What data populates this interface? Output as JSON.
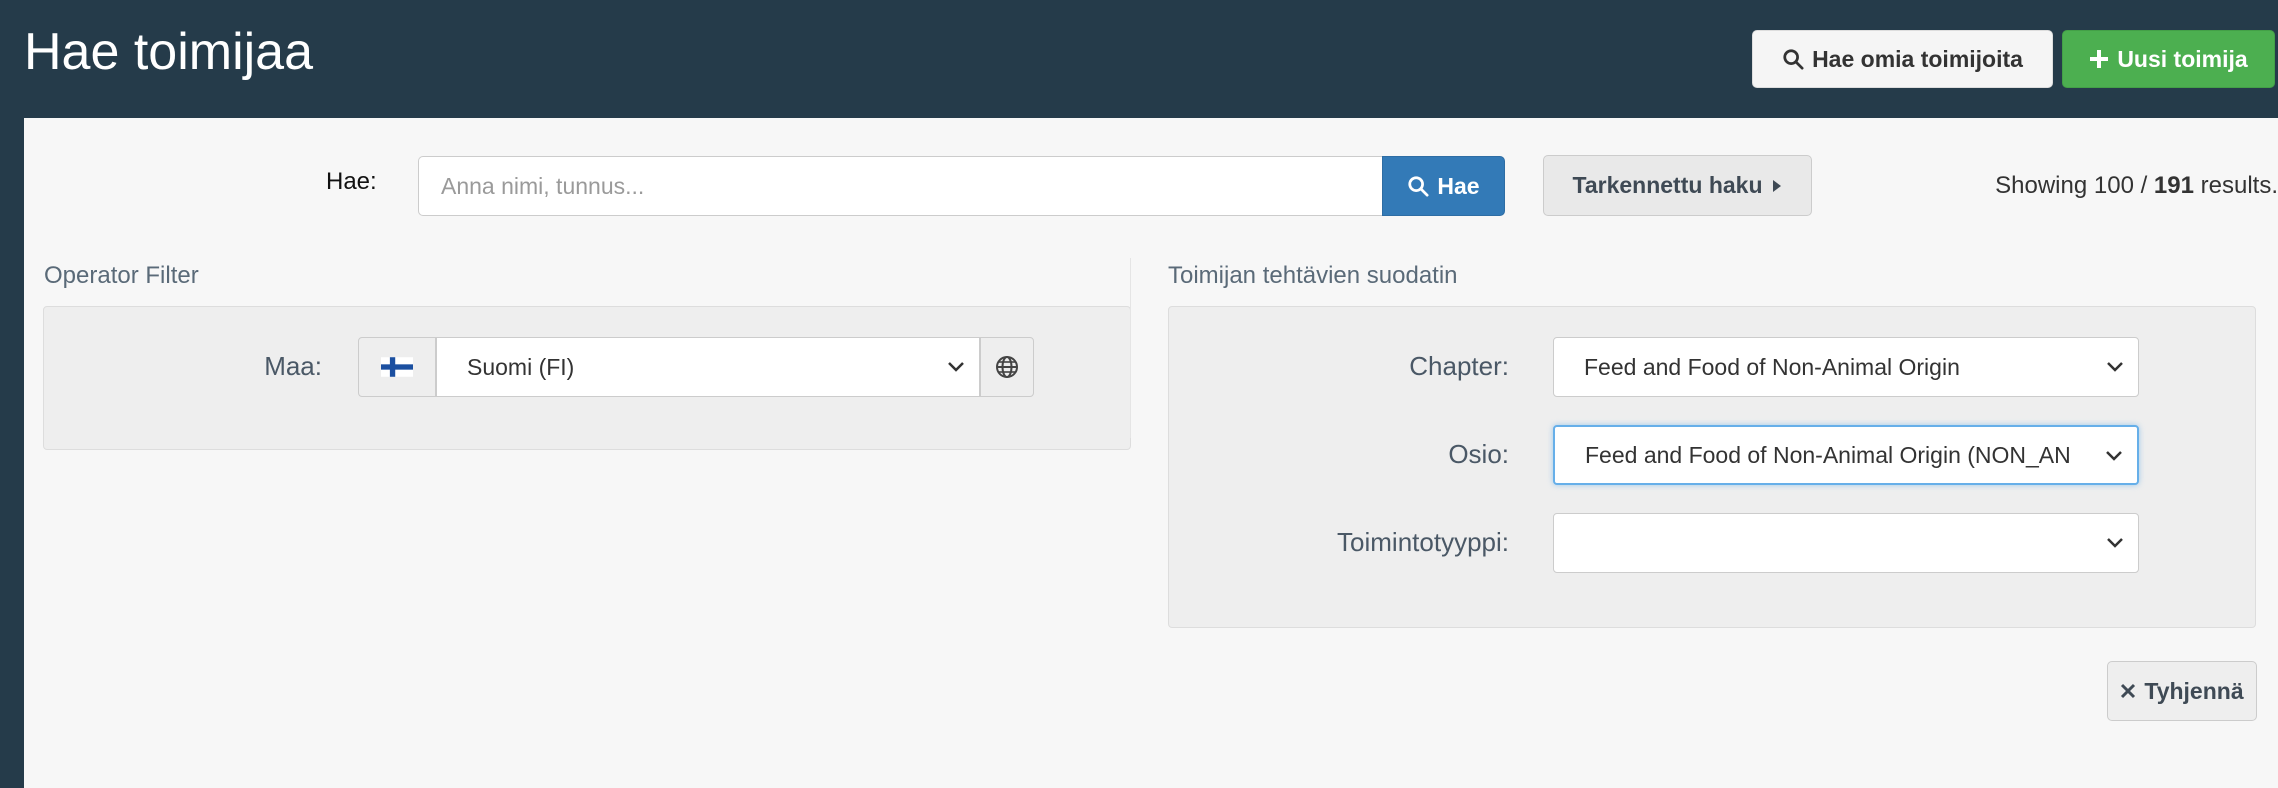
{
  "header": {
    "title": "Hae toimijaa",
    "own_button_label": "Hae omia toimijoita",
    "new_button_label": "Uusi toimija"
  },
  "search": {
    "label": "Hae:",
    "placeholder": "Anna nimi, tunnus...",
    "value": "",
    "button_label": "Hae",
    "advanced_label": "Tarkennettu haku"
  },
  "results": {
    "prefix": "Showing 100 / ",
    "total": "191",
    "suffix": " results."
  },
  "operator_filter": {
    "title": "Operator Filter",
    "country_label": "Maa:",
    "country_value": "Suomi (FI)"
  },
  "task_filter": {
    "title": "Toimijan tehtävien suodatin",
    "chapter_label": "Chapter:",
    "chapter_value": "Feed and Food of Non-Animal Origin",
    "section_label": "Osio:",
    "section_value": "Feed and Food of Non-Animal Origin (NON_AN",
    "activity_label": "Toimintotyyppi:",
    "activity_value": ""
  },
  "actions": {
    "clear_label": "Tyhjennä"
  },
  "colors": {
    "header_bg": "#253b4a",
    "primary": "#337ab7",
    "success": "#4caf50"
  }
}
